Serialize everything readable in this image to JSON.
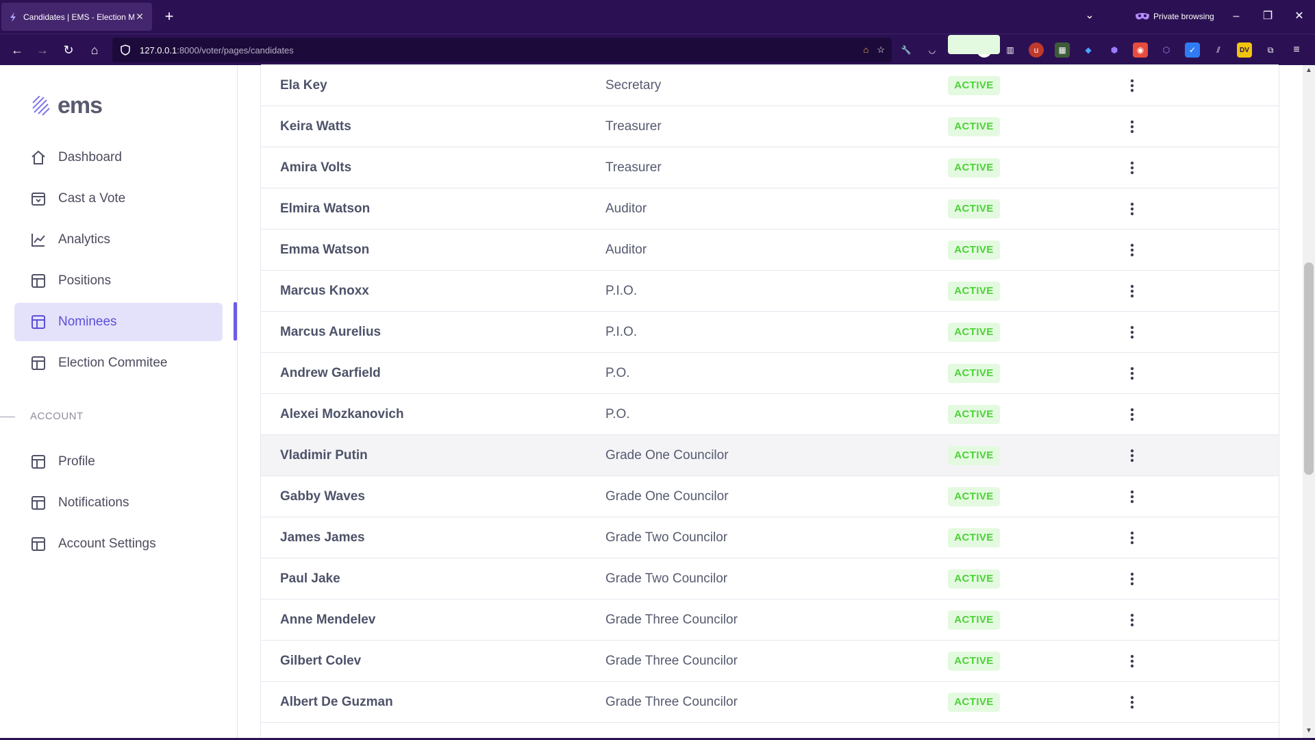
{
  "browser": {
    "tab_title": "Candidates | EMS - Election Ma",
    "new_tab_symbol": "+",
    "private_label": "Private browsing",
    "url_host": "127.0.0.1",
    "url_path": ":8000/voter/pages/candidates"
  },
  "sidebar": {
    "logo_text": "ems",
    "items": [
      {
        "label": "Dashboard",
        "icon": "home-icon"
      },
      {
        "label": "Cast a Vote",
        "icon": "vote-box-icon"
      },
      {
        "label": "Analytics",
        "icon": "chart-line-icon"
      },
      {
        "label": "Positions",
        "icon": "layout-icon"
      },
      {
        "label": "Nominees",
        "icon": "layout-icon",
        "active": true
      },
      {
        "label": "Election Commitee",
        "icon": "layout-icon"
      }
    ],
    "account_label": "ACCOUNT",
    "account_items": [
      {
        "label": "Profile",
        "icon": "layout-icon"
      },
      {
        "label": "Notifications",
        "icon": "layout-icon"
      },
      {
        "label": "Account Settings",
        "icon": "layout-icon"
      }
    ]
  },
  "table": {
    "rows": [
      {
        "name": "Ela Key",
        "position": "Secretary",
        "status": "ACTIVE"
      },
      {
        "name": "Keira Watts",
        "position": "Treasurer",
        "status": "ACTIVE"
      },
      {
        "name": "Amira Volts",
        "position": "Treasurer",
        "status": "ACTIVE"
      },
      {
        "name": "Elmira Watson",
        "position": "Auditor",
        "status": "ACTIVE"
      },
      {
        "name": "Emma Watson",
        "position": "Auditor",
        "status": "ACTIVE"
      },
      {
        "name": "Marcus Knoxx",
        "position": "P.I.O.",
        "status": "ACTIVE"
      },
      {
        "name": "Marcus Aurelius",
        "position": "P.I.O.",
        "status": "ACTIVE"
      },
      {
        "name": "Andrew Garfield",
        "position": "P.O.",
        "status": "ACTIVE"
      },
      {
        "name": "Alexei Mozkanovich",
        "position": "P.O.",
        "status": "ACTIVE"
      },
      {
        "name": "Vladimir Putin",
        "position": "Grade One Councilor",
        "status": "ACTIVE"
      },
      {
        "name": "Gabby Waves",
        "position": "Grade One Councilor",
        "status": "ACTIVE"
      },
      {
        "name": "James James",
        "position": "Grade Two Councilor",
        "status": "ACTIVE"
      },
      {
        "name": "Paul Jake",
        "position": "Grade Two Councilor",
        "status": "ACTIVE"
      },
      {
        "name": "Anne Mendelev",
        "position": "Grade Three Councilor",
        "status": "ACTIVE"
      },
      {
        "name": "Gilbert Colev",
        "position": "Grade Three Councilor",
        "status": "ACTIVE"
      },
      {
        "name": "Albert De Guzman",
        "position": "Grade Three Councilor",
        "status": "ACTIVE"
      }
    ]
  },
  "colors": {
    "browser_chrome": "#2b1153",
    "accent": "#6c5ce7",
    "active_nav_bg": "#e4e2fb",
    "status_green": "#4cd137",
    "status_green_bg": "#e4fae0"
  }
}
